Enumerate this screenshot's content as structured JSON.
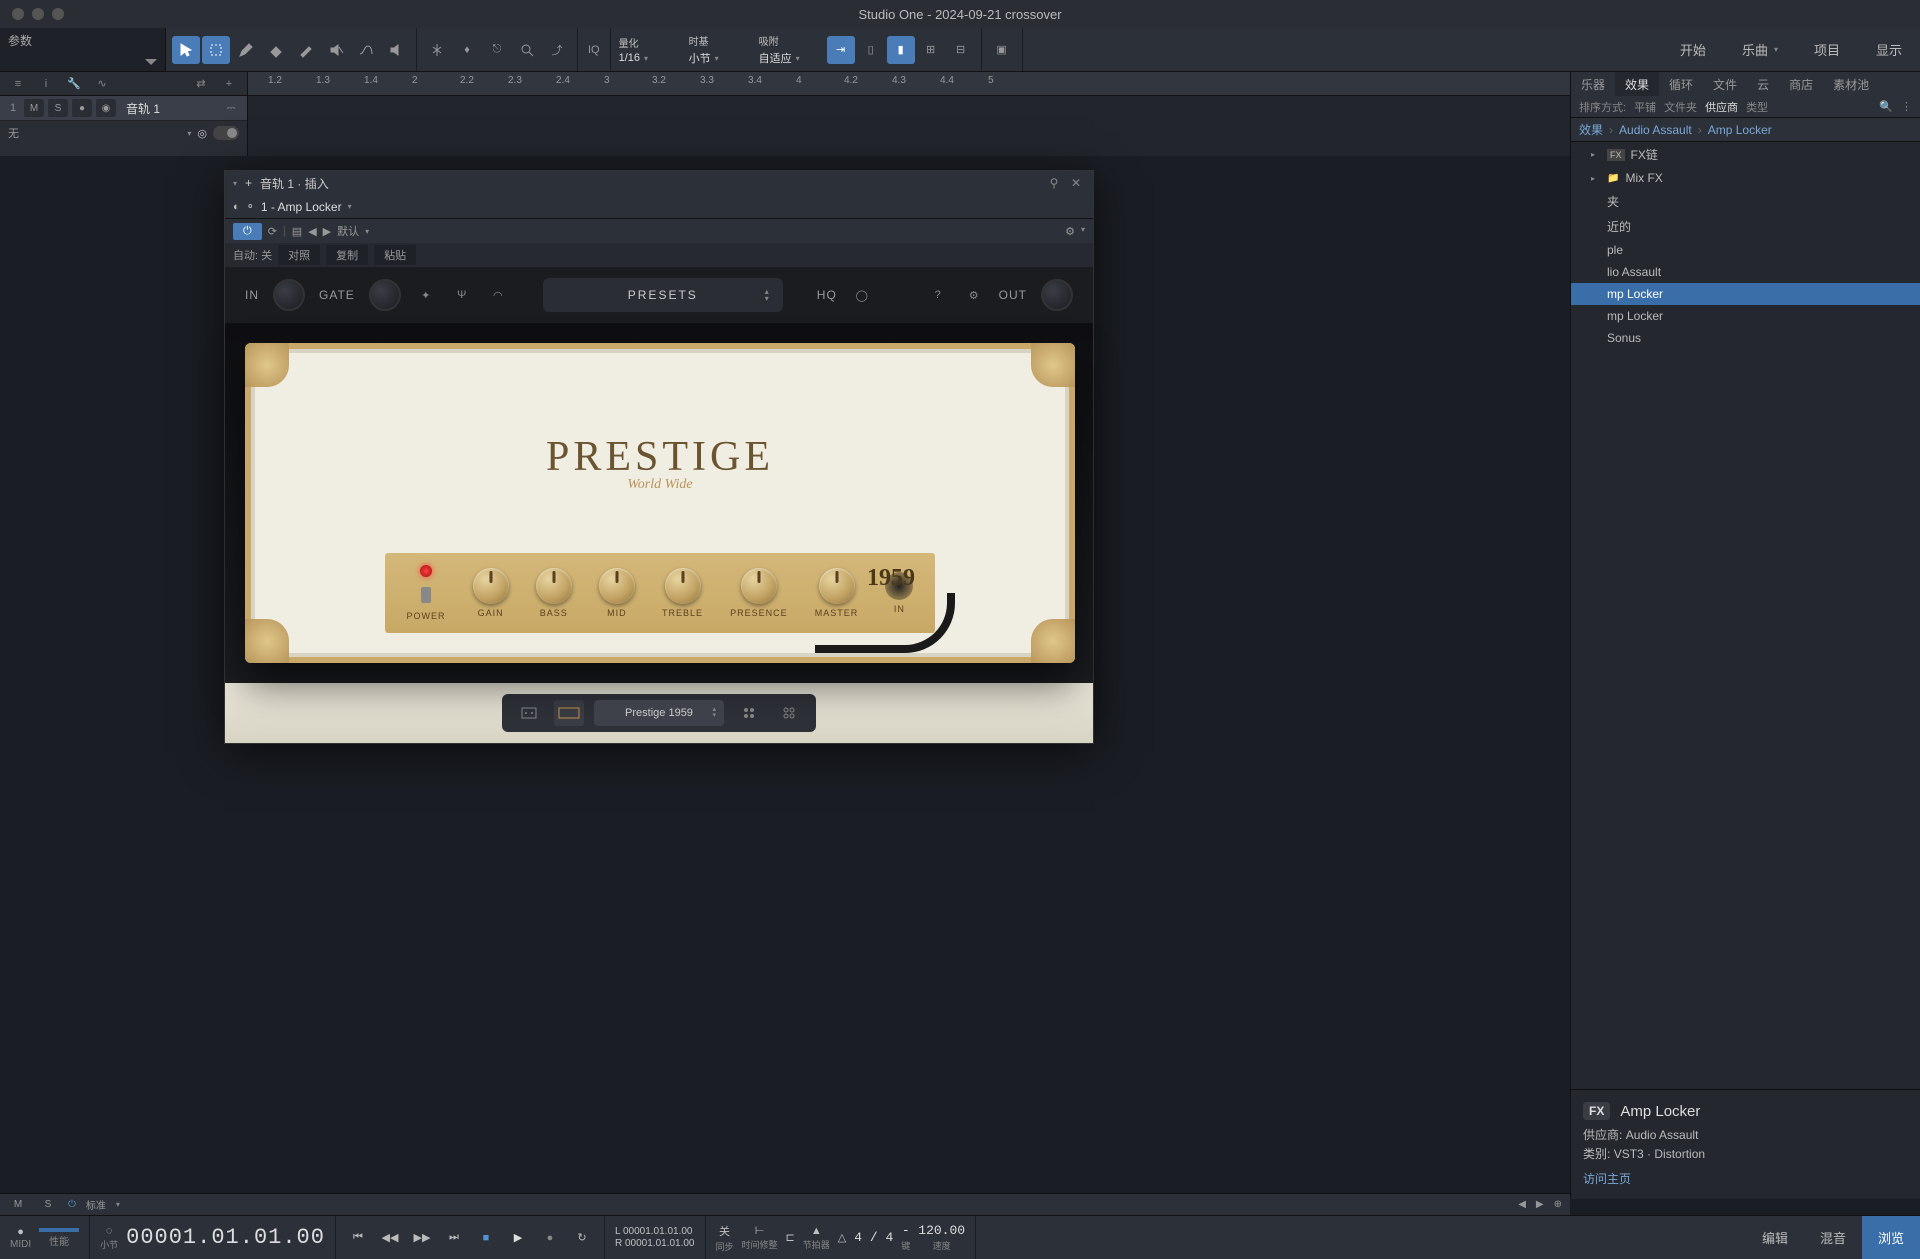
{
  "app_title": "Studio One - 2024-09-21 crossover",
  "param_label": "参数",
  "quantize": {
    "label": "量化",
    "value": "1/16"
  },
  "timebase": {
    "label": "时基",
    "value": "小节"
  },
  "snap": {
    "label": "吸附",
    "value": "自适应"
  },
  "iq_label": "IQ",
  "menu": {
    "start": "开始",
    "song": "乐曲",
    "project": "项目",
    "view": "显示"
  },
  "ruler": [
    "1.2",
    "1.3",
    "1.4",
    "2",
    "2.2",
    "2.3",
    "2.4",
    "3",
    "3.2",
    "3.3",
    "3.4",
    "4",
    "4.2",
    "4.3",
    "4.4",
    "5"
  ],
  "track": {
    "num": "1",
    "mute": "M",
    "solo": "S",
    "name": "音轨 1",
    "input": "无"
  },
  "plugin": {
    "title": "音轨 1 · 插入",
    "slot": "1 - Amp Locker",
    "auto": "自动: 关",
    "compare": "对照",
    "copy": "复制",
    "paste": "粘贴",
    "default": "默认",
    "in": "IN",
    "gate": "GATE",
    "presets": "PRESETS",
    "hq": "HQ",
    "out": "OUT",
    "amp_name": "PRESTIGE",
    "amp_sub": "World Wide",
    "amp_year": "1959",
    "knobs": [
      "POWER",
      "GAIN",
      "BASS",
      "MID",
      "TREBLE",
      "PRESENCE",
      "MASTER",
      "IN"
    ],
    "footer_sel": "Prestige 1959"
  },
  "browser": {
    "tabs": [
      "乐器",
      "效果",
      "循环",
      "文件",
      "云",
      "商店",
      "素材池"
    ],
    "active_tab": 1,
    "sort_label": "排序方式:",
    "sort_opts": [
      "平铺",
      "文件夹",
      "供应商",
      "类型"
    ],
    "sort_active": "供应商",
    "crumb": [
      "效果",
      "Audio Assault",
      "Amp Locker"
    ],
    "items": [
      {
        "label": "FX链",
        "icon": "fx",
        "arrow": true
      },
      {
        "label": "Mix FX",
        "icon": "folder",
        "arrow": true
      },
      {
        "label": "夹",
        "partial": true
      },
      {
        "label": "近的",
        "partial": true
      },
      {
        "label": "ple",
        "partial": true
      },
      {
        "label": "lio Assault",
        "partial": true
      },
      {
        "label": "mp Locker",
        "sel": true
      },
      {
        "label": "mp Locker",
        "partial": true
      },
      {
        "label": "Sonus",
        "partial": true
      }
    ],
    "info": {
      "fx_badge": "FX",
      "title": "Amp Locker",
      "vendor_label": "供应商:",
      "vendor": "Audio Assault",
      "type_label": "类别:",
      "type": "VST3 · Distortion",
      "link": "访问主页"
    }
  },
  "status": {
    "m": "M",
    "s": "S",
    "std": "标准"
  },
  "transport": {
    "midi": "MIDI",
    "perf": "性能",
    "bars_label": "小节",
    "timecode": "00001.01.01.00",
    "pos_l": "00001.01.01.00",
    "pos_r": "00001.01.01.00",
    "l": "L",
    "r": "R",
    "sync_off": "关",
    "sync": "同步",
    "realtime": "时间修整",
    "metronome": "节拍器",
    "sig": "4 / 4",
    "key": "-",
    "tempo": "120.00",
    "tempo_label": "速度",
    "key_label": "键",
    "edit": "编辑",
    "mix": "混音",
    "browse": "浏览"
  }
}
